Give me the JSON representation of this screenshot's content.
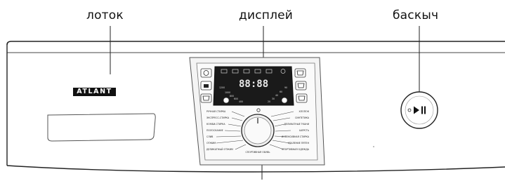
{
  "callouts": {
    "tray": "лоток",
    "display": "дисплей",
    "button": "баскыч"
  },
  "brand": "ATLANT",
  "display": {
    "digits": "88:88",
    "speeds": [
      "1200",
      "1000",
      "800",
      "600",
      "400"
    ],
    "temps": [
      "90",
      "60",
      "40",
      "30",
      "20"
    ]
  },
  "programs_left": [
    "РУЧНАЯ СТИРКА",
    "ЭКСПРЕСС-СТИРКА",
    "КОМБИ-СТИРКА",
    "ПОЛОСКАНИЕ",
    "СЛИВ",
    "ОТЖИМ",
    "ДЕЛИКАТНЫЙ ОТЖИМ"
  ],
  "programs_right": [
    "ХЛОПОК",
    "СИНТЕТИКА",
    "ДЕЛИКАТНЫЕ ТКАНИ",
    "ШЕРСТЬ",
    "ИНТЕНСИВНАЯ СТИРКА",
    "УДАЛЕНИЕ ПЯТЕН",
    "СПОРТИВНАЯ ОДЕЖДА"
  ],
  "program_bottom": "СПОРТИВНАЯ ОБУВЬ",
  "colors": {
    "line": "#333333",
    "display_bg": "#1a1a1a",
    "panel": "#f2f2f2"
  }
}
